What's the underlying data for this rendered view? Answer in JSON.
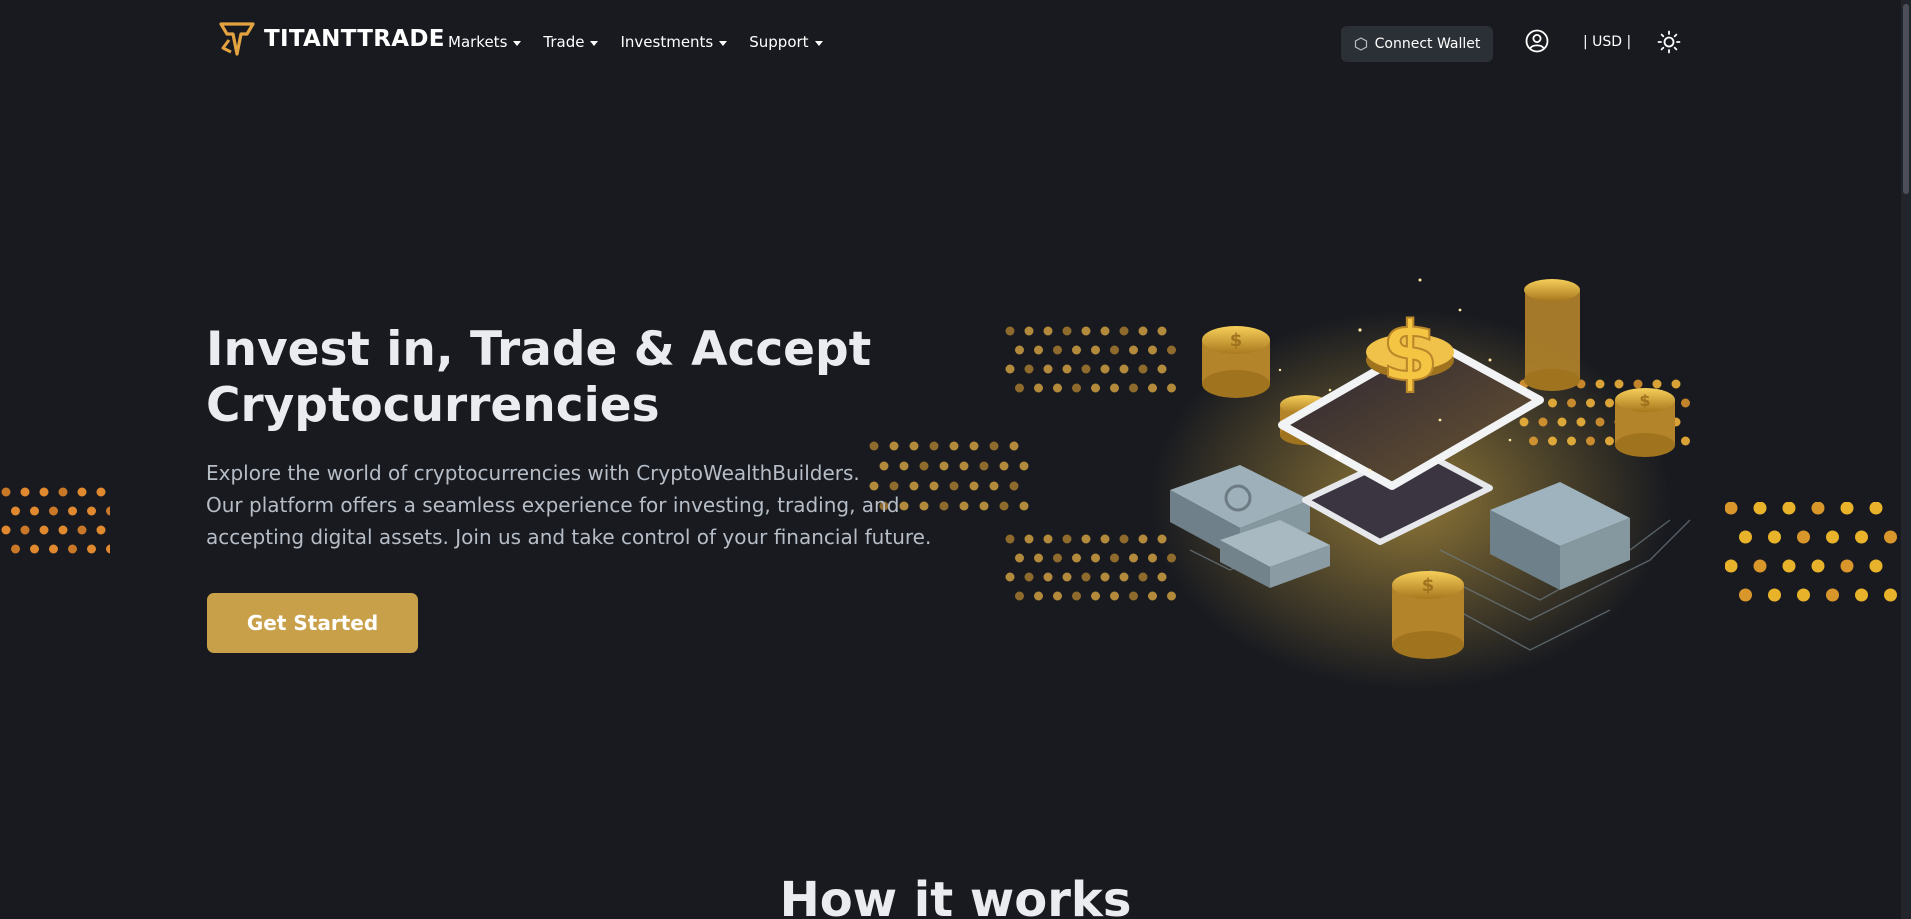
{
  "brand": {
    "name": "TITANTTRADE",
    "accent": "#c9a04a"
  },
  "nav": {
    "menu": [
      {
        "label": "Markets"
      },
      {
        "label": "Trade"
      },
      {
        "label": "Investments"
      },
      {
        "label": "Support"
      }
    ],
    "connect_wallet": "Connect Wallet",
    "currency": "| USD |",
    "icons": {
      "user": "user-circle-icon",
      "theme": "sun-icon",
      "wallet": "wallet-icon"
    }
  },
  "hero": {
    "title_line1": "Invest in, Trade & Accept",
    "title_line2": "Cryptocurrencies",
    "desc_line1": "Explore the world of cryptocurrencies with CryptoWealthBuilders.",
    "desc_line2": "Our platform offers a seamless experience for investing, trading, and",
    "desc_line3": "accepting digital assets. Join us and take control of your financial future.",
    "cta": "Get Started"
  },
  "section": {
    "title": "How it works"
  }
}
